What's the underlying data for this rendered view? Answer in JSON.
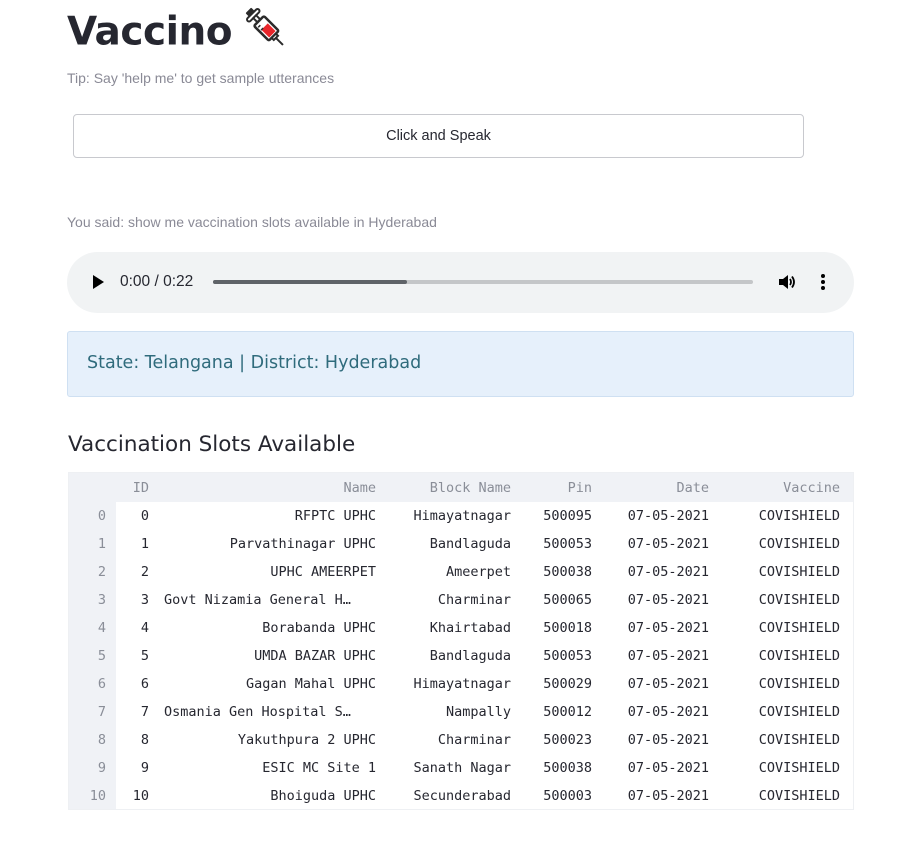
{
  "app": {
    "title": "Vaccino",
    "title_icon": "syringe-icon",
    "tip": "Tip: Say 'help me' to get sample utterances",
    "speak_button_label": "Click and Speak",
    "you_said": "You said: show me vaccination slots available in Hyderabad"
  },
  "audio": {
    "time": "0:00 / 0:22",
    "progress_fraction": 0.36
  },
  "info": {
    "text": "State: Telangana | District: Hyderabad"
  },
  "section": {
    "title": "Vaccination Slots Available"
  },
  "table": {
    "columns": [
      "",
      "ID",
      "Name",
      "Block Name",
      "Pin",
      "Date",
      "Vaccine"
    ],
    "rows": [
      [
        "0",
        "0",
        "RFPTC UPHC",
        "Himayatnagar",
        "500095",
        "07-05-2021",
        "COVISHIELD"
      ],
      [
        "1",
        "1",
        "Parvathinagar UPHC",
        "Bandlaguda",
        "500053",
        "07-05-2021",
        "COVISHIELD"
      ],
      [
        "2",
        "2",
        "UPHC AMEERPET",
        "Ameerpet",
        "500038",
        "07-05-2021",
        "COVISHIELD"
      ],
      [
        "3",
        "3",
        "Govt Nizamia General H…",
        "Charminar",
        "500065",
        "07-05-2021",
        "COVISHIELD"
      ],
      [
        "4",
        "4",
        "Borabanda UPHC",
        "Khairtabad",
        "500018",
        "07-05-2021",
        "COVISHIELD"
      ],
      [
        "5",
        "5",
        "UMDA BAZAR UPHC",
        "Bandlaguda",
        "500053",
        "07-05-2021",
        "COVISHIELD"
      ],
      [
        "6",
        "6",
        "Gagan Mahal UPHC",
        "Himayatnagar",
        "500029",
        "07-05-2021",
        "COVISHIELD"
      ],
      [
        "7",
        "7",
        "Osmania Gen Hospital S…",
        "Nampally",
        "500012",
        "07-05-2021",
        "COVISHIELD"
      ],
      [
        "8",
        "8",
        "Yakuthpura 2 UPHC",
        "Charminar",
        "500023",
        "07-05-2021",
        "COVISHIELD"
      ],
      [
        "9",
        "9",
        "ESIC MC Site 1",
        "Sanath Nagar",
        "500038",
        "07-05-2021",
        "COVISHIELD"
      ],
      [
        "10",
        "10",
        "Bhoiguda UPHC",
        "Secunderabad",
        "500003",
        "07-05-2021",
        "COVISHIELD"
      ]
    ]
  },
  "colors": {
    "text": "#262730",
    "muted": "#8a8a96",
    "info_bg": "#e6f0fb",
    "info_text": "#2f6b7c",
    "header_bg": "#f0f2f6",
    "audio_bg": "#f1f3f4"
  }
}
